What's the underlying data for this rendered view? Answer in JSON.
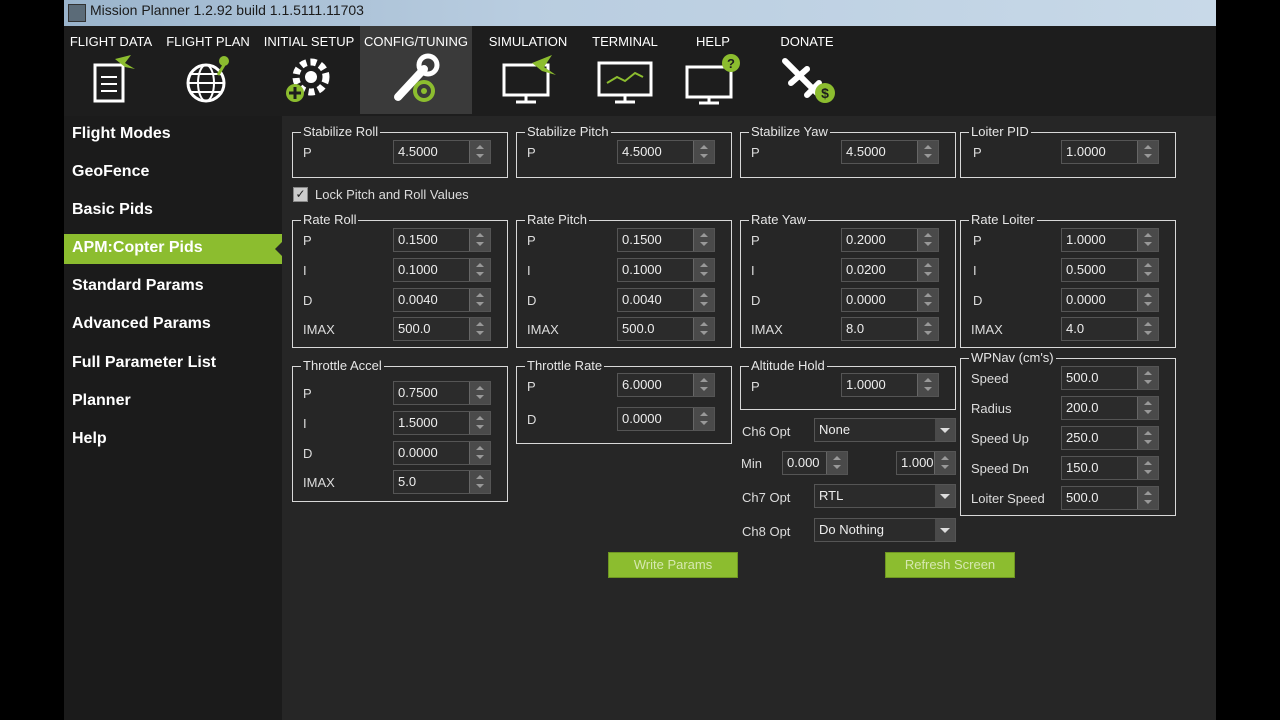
{
  "window": {
    "title": "Mission Planner 1.2.92 build 1.1.5111.11703"
  },
  "menu": [
    {
      "label": "FLIGHT DATA",
      "icon": "clipboard-plane-icon",
      "active": false
    },
    {
      "label": "FLIGHT PLAN",
      "icon": "globe-pin-icon",
      "active": false
    },
    {
      "label": "INITIAL SETUP",
      "icon": "gear-plus-icon",
      "active": false
    },
    {
      "label": "CONFIG/TUNING",
      "icon": "wrench-icon",
      "active": true
    },
    {
      "label": "SIMULATION",
      "icon": "monitor-plane-icon",
      "active": false
    },
    {
      "label": "TERMINAL",
      "icon": "monitor-terminal-icon",
      "active": false
    },
    {
      "label": "HELP",
      "icon": "monitor-help-icon",
      "active": false
    },
    {
      "label": "DONATE",
      "icon": "plane-dollar-icon",
      "active": false
    }
  ],
  "sidebar": {
    "items": [
      {
        "label": "Flight Modes",
        "active": false
      },
      {
        "label": "GeoFence",
        "active": false
      },
      {
        "label": "Basic Pids",
        "active": false
      },
      {
        "label": "APM:Copter Pids",
        "active": true
      },
      {
        "label": "Standard Params",
        "active": false
      },
      {
        "label": "Advanced Params",
        "active": false
      },
      {
        "label": "Full Parameter List",
        "active": false
      },
      {
        "label": "Planner",
        "active": false
      },
      {
        "label": "Help",
        "active": false
      }
    ]
  },
  "groups": {
    "stab_roll": {
      "title": "Stabilize Roll",
      "p_label": "P",
      "p": "4.5000"
    },
    "stab_pitch": {
      "title": "Stabilize Pitch",
      "p_label": "P",
      "p": "4.5000"
    },
    "stab_yaw": {
      "title": "Stabilize Yaw",
      "p_label": "P",
      "p": "4.5000"
    },
    "loiter_pid": {
      "title": "Loiter PID",
      "p_label": "P",
      "p": "1.0000"
    },
    "lock": {
      "label": "Lock Pitch and Roll Values",
      "checked": true,
      "mark": "✓"
    },
    "rate_roll": {
      "title": "Rate Roll",
      "p_label": "P",
      "i_label": "I",
      "d_label": "D",
      "imax_label": "IMAX",
      "p": "0.1500",
      "i": "0.1000",
      "d": "0.0040",
      "imax": "500.0"
    },
    "rate_pitch": {
      "title": "Rate Pitch",
      "p_label": "P",
      "i_label": "I",
      "d_label": "D",
      "imax_label": "IMAX",
      "p": "0.1500",
      "i": "0.1000",
      "d": "0.0040",
      "imax": "500.0"
    },
    "rate_yaw": {
      "title": "Rate Yaw",
      "p_label": "P",
      "i_label": "I",
      "d_label": "D",
      "imax_label": "IMAX",
      "p": "0.2000",
      "i": "0.0200",
      "d": "0.0000",
      "imax": "8.0"
    },
    "rate_loiter": {
      "title": "Rate Loiter",
      "p_label": "P",
      "i_label": "I",
      "d_label": "D",
      "imax_label": "IMAX",
      "p": "1.0000",
      "i": "0.5000",
      "d": "0.0000",
      "imax": "4.0"
    },
    "throttle_accel": {
      "title": "Throttle Accel",
      "p_label": "P",
      "i_label": "I",
      "d_label": "D",
      "imax_label": "IMAX",
      "p": "0.7500",
      "i": "1.5000",
      "d": "0.0000",
      "imax": "5.0"
    },
    "throttle_rate": {
      "title": "Throttle Rate",
      "p_label": "P",
      "d_label": "D",
      "p": "6.0000",
      "d": "0.0000"
    },
    "altitude_hold": {
      "title": "Altitude Hold",
      "p_label": "P",
      "p": "1.0000"
    },
    "wpnav": {
      "title": "WPNav (cm's)",
      "speed_label": "Speed",
      "speed": "500.0",
      "radius_label": "Radius",
      "radius": "200.0",
      "speed_up_label": "Speed Up",
      "speed_up": "250.0",
      "speed_dn_label": "Speed Dn",
      "speed_dn": "150.0",
      "loiter_speed_label": "Loiter Speed",
      "loiter_speed": "500.0"
    },
    "ch6": {
      "label": "Ch6 Opt",
      "value": "None",
      "min_label": "Min",
      "min": "0.000",
      "max": "1.000"
    },
    "ch7": {
      "label": "Ch7 Opt",
      "value": "RTL"
    },
    "ch8": {
      "label": "Ch8 Opt",
      "value": "Do Nothing"
    }
  },
  "buttons": {
    "write": "Write Params",
    "refresh": "Refresh Screen"
  },
  "colors": {
    "accent": "#8cbd2f",
    "background": "#262626",
    "menubar": "#1d1d1d"
  }
}
